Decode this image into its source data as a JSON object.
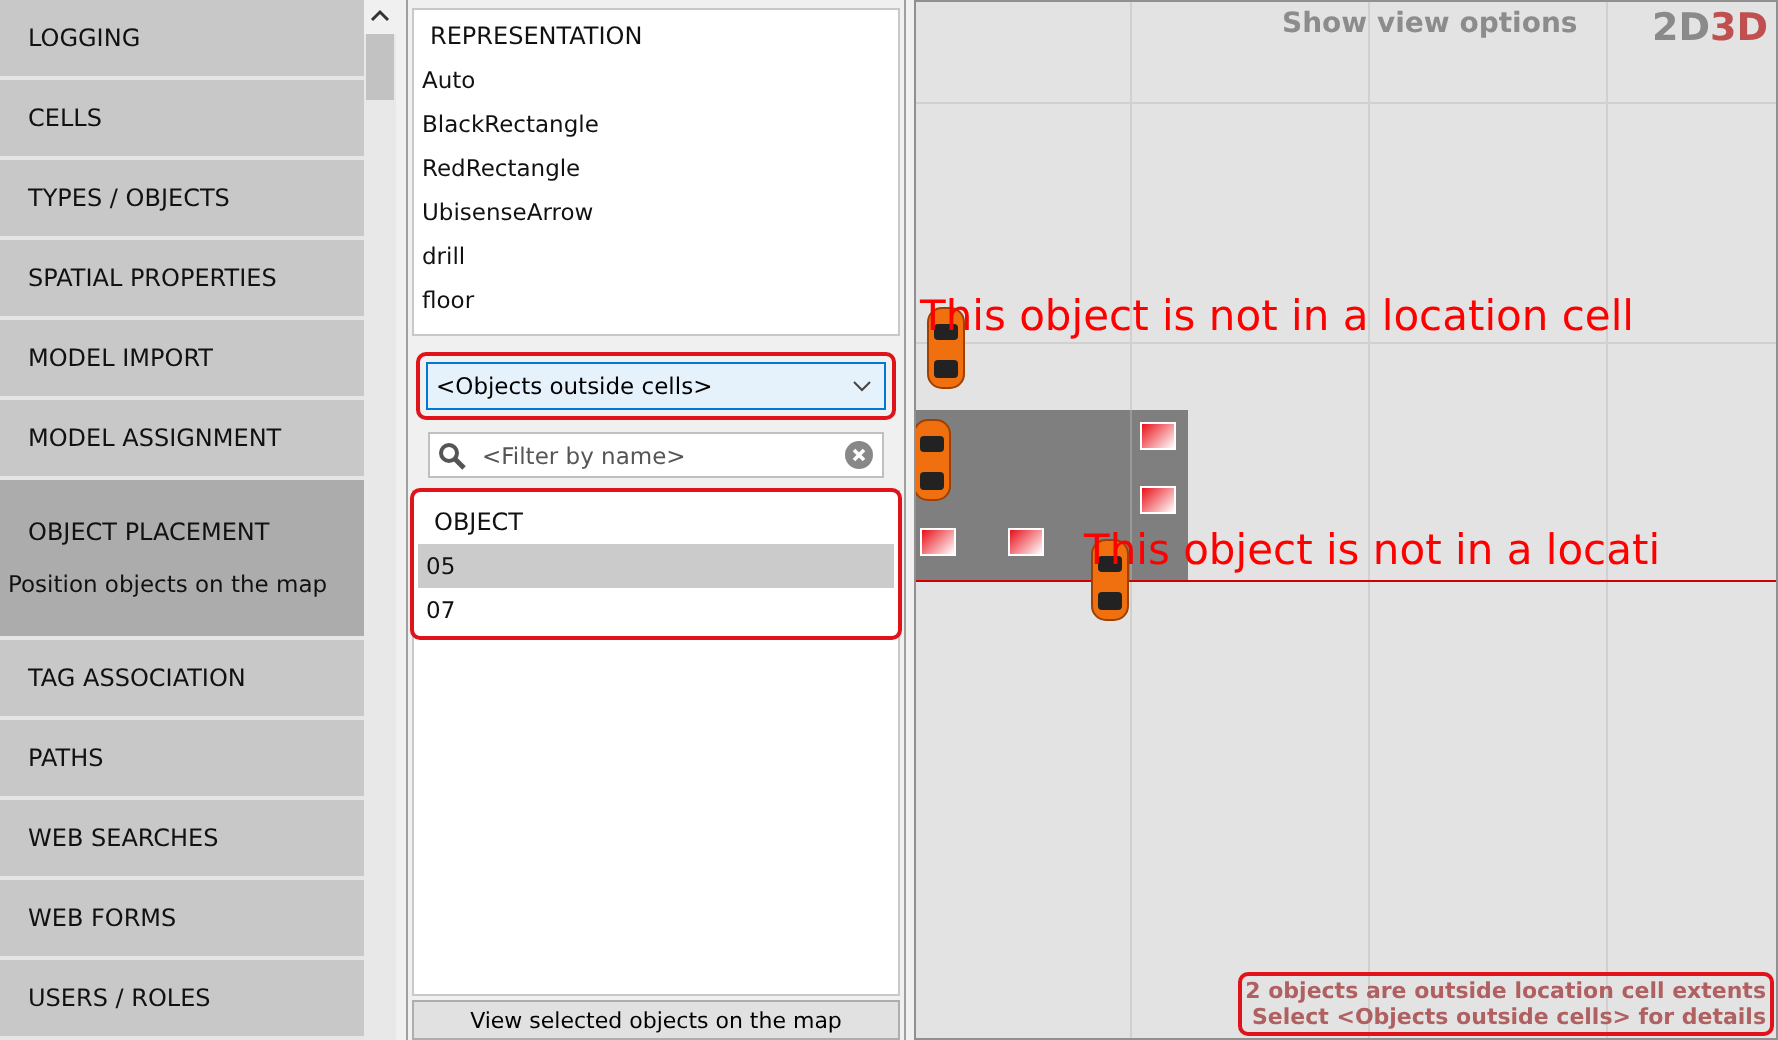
{
  "sidebar": {
    "items": [
      {
        "label": "LOGGING",
        "selected": false
      },
      {
        "label": "CELLS",
        "selected": false
      },
      {
        "label": "TYPES / OBJECTS",
        "selected": false
      },
      {
        "label": "SPATIAL PROPERTIES",
        "selected": false
      },
      {
        "label": "MODEL IMPORT",
        "selected": false
      },
      {
        "label": "MODEL ASSIGNMENT",
        "selected": false
      },
      {
        "label": "OBJECT PLACEMENT",
        "selected": true,
        "description": "Position objects on the map"
      },
      {
        "label": "TAG ASSOCIATION",
        "selected": false
      },
      {
        "label": "PATHS",
        "selected": false
      },
      {
        "label": "WEB SEARCHES",
        "selected": false
      },
      {
        "label": "WEB FORMS",
        "selected": false
      },
      {
        "label": "USERS / ROLES",
        "selected": false
      }
    ]
  },
  "representation_list": {
    "header": "REPRESENTATION",
    "items": [
      "Auto",
      "BlackRectangle",
      "RedRectangle",
      "UbisenseArrow",
      "drill",
      "floor"
    ]
  },
  "cell_dropdown": {
    "value": "<Objects outside cells>"
  },
  "filter": {
    "placeholder": "<Filter by name>"
  },
  "object_list": {
    "header": "OBJECT",
    "rows": [
      {
        "label": "05",
        "selected": true
      },
      {
        "label": "07",
        "selected": false
      }
    ]
  },
  "view_button": "View selected objects on the map",
  "map": {
    "view_options": "Show view options",
    "mode_2d": "2D",
    "mode_3d": "3D",
    "warnings": [
      "This object is not in a location cell",
      "This object is not in a locati"
    ],
    "status": [
      "2 objects are outside location cell extents",
      "Select <Objects outside cells> for details"
    ]
  }
}
